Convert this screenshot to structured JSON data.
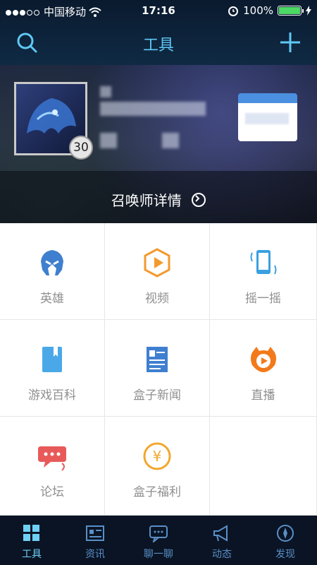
{
  "status_bar": {
    "carrier": "中国移动",
    "time": "17:16",
    "battery": "100%",
    "battery_level": 1.0
  },
  "navbar": {
    "title": "工具",
    "search_icon": "search-icon",
    "add_icon": "plus-icon"
  },
  "profile": {
    "level": "30",
    "summoner_details_label": "召唤师详情"
  },
  "tools": [
    {
      "label": "英雄",
      "icon": "hero-helmet-icon",
      "color": "#3f7fcf"
    },
    {
      "label": "视频",
      "icon": "video-hexagon-icon",
      "color": "#f29a2e"
    },
    {
      "label": "摇一摇",
      "icon": "shake-phone-icon",
      "color": "#3aa0e0"
    },
    {
      "label": "游戏百科",
      "icon": "encyclopedia-book-icon",
      "color": "#4aa8e8"
    },
    {
      "label": "盒子新闻",
      "icon": "news-document-icon",
      "color": "#3f7fcf"
    },
    {
      "label": "直播",
      "icon": "live-stream-icon",
      "color": "#f27a1a"
    },
    {
      "label": "论坛",
      "icon": "forum-chat-icon",
      "color": "#e85a5a"
    },
    {
      "label": "盒子福利",
      "icon": "yuan-coin-icon",
      "color": "#f2a72e"
    }
  ],
  "tabs": [
    {
      "label": "工具",
      "icon": "tools-grid-icon",
      "active": true
    },
    {
      "label": "资讯",
      "icon": "news-card-icon",
      "active": false
    },
    {
      "label": "聊一聊",
      "icon": "chat-bubble-icon",
      "active": false
    },
    {
      "label": "动态",
      "icon": "megaphone-icon",
      "active": false
    },
    {
      "label": "发现",
      "icon": "compass-icon",
      "active": false
    }
  ]
}
